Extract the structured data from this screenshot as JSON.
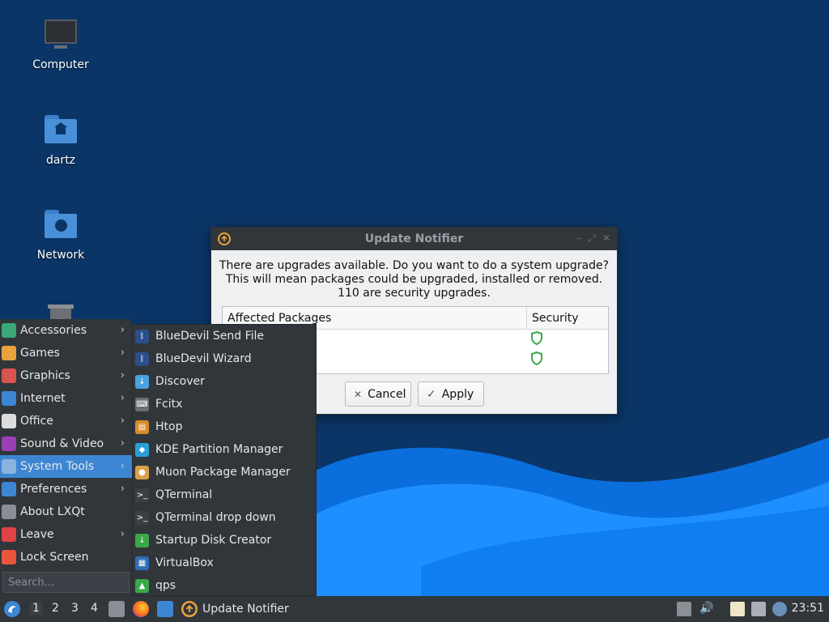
{
  "desktop": {
    "icons": [
      {
        "label": "Computer",
        "icon": "monitor-icon"
      },
      {
        "label": "dartz",
        "icon": "home-folder-icon"
      },
      {
        "label": "Network",
        "icon": "network-folder-icon"
      },
      {
        "label": "",
        "icon": "trash-icon"
      }
    ]
  },
  "dialog": {
    "title": "Update Notifier",
    "message": [
      "There are upgrades available. Do you want to do a system upgrade?",
      "This will mean packages could be upgraded, installed or removed.",
      "110 are security upgrades."
    ],
    "table": {
      "headers": [
        "Affected Packages",
        "Security"
      ],
      "rows": [
        {
          "package": "",
          "security": "shield-icon"
        },
        {
          "package": "",
          "security": "shield-icon"
        }
      ]
    },
    "cancel_label": "Cancel",
    "apply_label": "Apply",
    "cancel_glyph": "✕",
    "apply_glyph": "✓"
  },
  "menu": {
    "items": [
      {
        "label": "Accessories",
        "arrow": "›",
        "color": "#3aa878"
      },
      {
        "label": "Games",
        "arrow": "›",
        "color": "#e8a33c"
      },
      {
        "label": "Graphics",
        "arrow": "›",
        "color": "#d9534f"
      },
      {
        "label": "Internet",
        "arrow": "›",
        "color": "#3d86d4"
      },
      {
        "label": "Office",
        "arrow": "›",
        "color": "#dcdcdc"
      },
      {
        "label": "Sound & Video",
        "arrow": "›",
        "color": "#9b3fb5"
      },
      {
        "label": "System Tools",
        "arrow": "›",
        "color": "#8ab4e0"
      },
      {
        "label": "Preferences",
        "arrow": "›",
        "color": "#3d86d4"
      },
      {
        "label": "About LXQt",
        "arrow": "",
        "color": "#8a8f95"
      },
      {
        "label": "Leave",
        "arrow": "›",
        "color": "#e04343"
      },
      {
        "label": "Lock Screen",
        "arrow": "",
        "color": "#e8553c"
      }
    ],
    "active_index": 6,
    "search_placeholder": "Search..."
  },
  "submenu": {
    "items": [
      {
        "label": "BlueDevil Send File",
        "color": "#2b4f8c",
        "glyph": "ᛒ"
      },
      {
        "label": "BlueDevil Wizard",
        "color": "#2b4f8c",
        "glyph": "ᛒ"
      },
      {
        "label": "Discover",
        "color": "#4aa3df",
        "glyph": "↓"
      },
      {
        "label": "Fcitx",
        "color": "#6b7077",
        "glyph": "⌨"
      },
      {
        "label": "Htop",
        "color": "#d98b2b",
        "glyph": "▤"
      },
      {
        "label": "KDE Partition Manager",
        "color": "#2a9fd6",
        "glyph": "◆"
      },
      {
        "label": "Muon Package Manager",
        "color": "#d9a04a",
        "glyph": "●"
      },
      {
        "label": "QTerminal",
        "color": "#3b4046",
        "glyph": ">_"
      },
      {
        "label": "QTerminal drop down",
        "color": "#3b4046",
        "glyph": ">_"
      },
      {
        "label": "Startup Disk Creator",
        "color": "#3aa84a",
        "glyph": "↓"
      },
      {
        "label": "VirtualBox",
        "color": "#2f6fb5",
        "glyph": "▦"
      },
      {
        "label": "qps",
        "color": "#3aa84a",
        "glyph": "▲"
      }
    ]
  },
  "taskbar": {
    "workspaces": [
      "1",
      "2",
      "3",
      "4"
    ],
    "active_workspace": "1",
    "task_label": "Update Notifier",
    "clock": "23:51"
  },
  "colors": {
    "desktop_bg": "#0a3566",
    "wave_light": "#1e8fff",
    "wave_mid": "#0a6fdc",
    "panel": "#31363b",
    "accent": "#3d86d4",
    "security_green": "#3aa84a"
  }
}
